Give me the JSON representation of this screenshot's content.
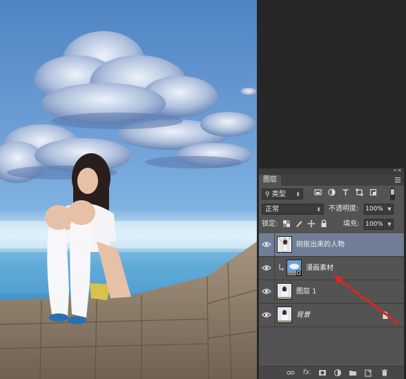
{
  "layers_panel": {
    "tab_label": "图层",
    "filter": {
      "kind_label": "类型"
    },
    "blend_mode": {
      "value": "正常"
    },
    "opacity": {
      "label": "不透明度:",
      "value": "100%"
    },
    "lock": {
      "label": "锁定:"
    },
    "fill": {
      "label": "填充:",
      "value": "100%"
    },
    "layers": [
      {
        "name": "刚抠出来的人物",
        "selected": true,
        "visible": true
      },
      {
        "name": "漫画素材",
        "selected": false,
        "visible": true,
        "clipped": true
      },
      {
        "name": "图层 1",
        "selected": false,
        "visible": true
      },
      {
        "name": "背景",
        "selected": false,
        "visible": true,
        "locked": true
      }
    ],
    "footer_icons": [
      "link-icon",
      "fx-icon",
      "mask-icon",
      "adjustment-icon",
      "group-folder-icon",
      "new-layer-icon",
      "trash-icon"
    ],
    "footer_fx_label": "fx."
  },
  "colors": {
    "selected_layer": "#6f7e96",
    "panel_bg": "#535353",
    "annotation_arrow": "#e0241e"
  }
}
